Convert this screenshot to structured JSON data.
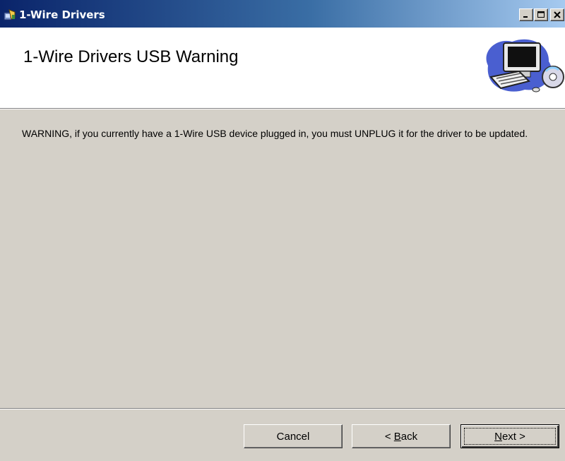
{
  "window": {
    "title": "1-Wire Drivers",
    "controls": {
      "minimize": "_",
      "maximize": "□",
      "close": "X"
    }
  },
  "banner": {
    "title": "1-Wire Drivers USB Warning",
    "icon": "computer-cd-icon"
  },
  "body": {
    "message": "WARNING, if you currently have a 1-Wire USB device plugged in, you must UNPLUG it for the driver to be updated."
  },
  "buttons": {
    "cancel": "Cancel",
    "back_prefix": "< ",
    "back_accel": "B",
    "back_rest": "ack",
    "next_accel": "N",
    "next_rest": "ext >"
  }
}
